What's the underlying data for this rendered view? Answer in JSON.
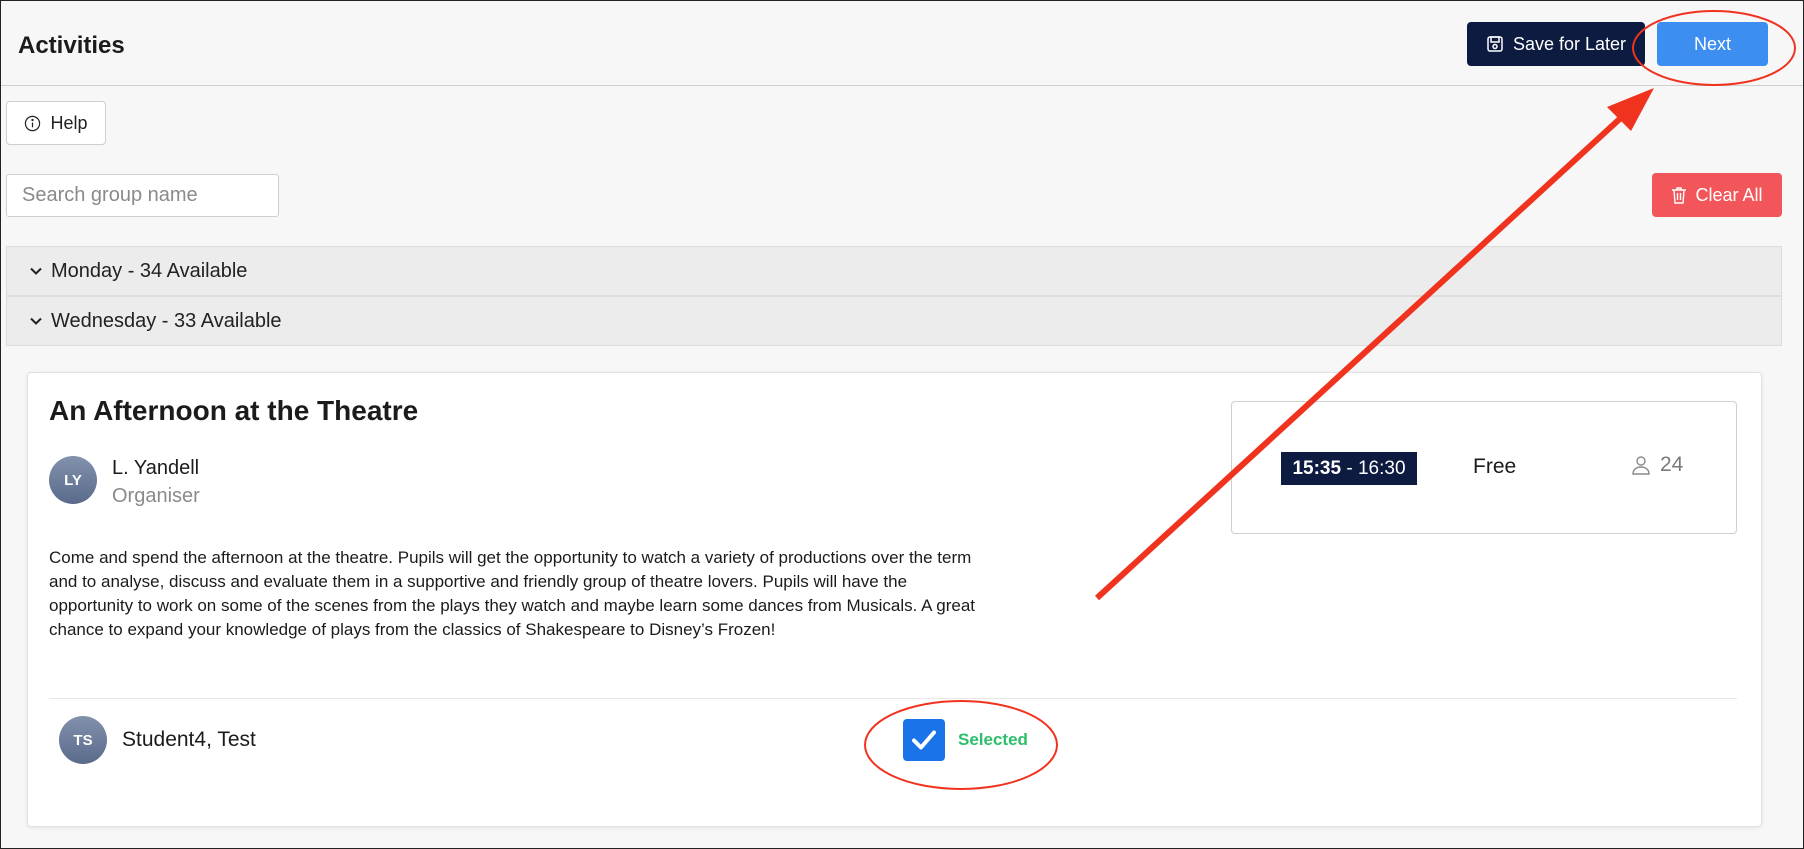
{
  "header": {
    "title": "Activities",
    "save_label": "Save for Later",
    "next_label": "Next",
    "save_icon": "save-icon"
  },
  "toolbar": {
    "help_label": "Help",
    "help_icon": "info-icon",
    "clear_all_label": "Clear All",
    "clear_icon": "trash-icon"
  },
  "search": {
    "placeholder": "Search group name",
    "value": ""
  },
  "days": [
    {
      "label": "Monday - 34 Available"
    },
    {
      "label": "Wednesday - 33 Available"
    }
  ],
  "activity": {
    "title": "An Afternoon at the Theatre",
    "organiser": {
      "initials": "LY",
      "name": "L. Yandell",
      "role": "Organiser"
    },
    "description": "Come and spend the afternoon at the theatre. Pupils will get the opportunity to watch a variety of productions over the term and to analyse, discuss and evaluate them in a supportive and friendly group of theatre lovers. Pupils will have the opportunity to work on some of the scenes from the plays they watch and maybe learn some dances from Musicals. A great chance to expand your knowledge of plays from the classics of Shakespeare to Disney’s Frozen!",
    "session": {
      "time_start": "15:35",
      "time_sep": " - ",
      "time_end": "16:30",
      "price": "Free",
      "spaces": "24",
      "spaces_icon": "person-icon"
    },
    "student": {
      "initials": "TS",
      "name": "Student4, Test",
      "checked": true,
      "status": "Selected"
    }
  },
  "colors": {
    "navy": "#0e1b40",
    "primary": "#3c8ff0",
    "danger": "#f2565b",
    "success": "#2dbe6c",
    "annotation": "#f0331f"
  }
}
